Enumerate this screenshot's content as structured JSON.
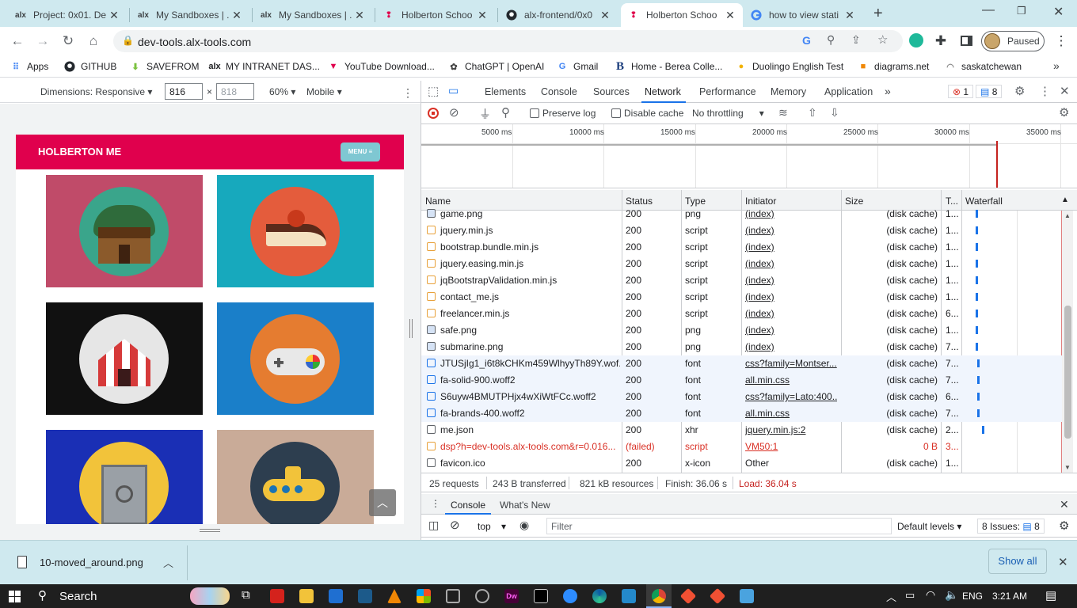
{
  "tabs": [
    {
      "icon": "alx",
      "title": "Project: 0x01. De"
    },
    {
      "icon": "alx",
      "title": "My Sandboxes | ."
    },
    {
      "icon": "alx",
      "title": "My Sandboxes | ."
    },
    {
      "icon": "holberton",
      "title": "Holberton Schoo"
    },
    {
      "icon": "github",
      "title": "alx-frontend/0x0"
    },
    {
      "icon": "holberton",
      "title": "Holberton Schoo"
    },
    {
      "icon": "google",
      "title": "how to view stati"
    }
  ],
  "address_bar": {
    "url": "dev-tools.alx-tools.com"
  },
  "profile": {
    "label": "Paused"
  },
  "bookmarks": [
    "Apps",
    "GITHUB",
    "SAVEFROM",
    "MY INTRANET DAS...",
    "YouTube Download...",
    "ChatGPT | OpenAI",
    "Gmail",
    "Home - Berea Colle...",
    "Duolingo English Test",
    "diagrams.net",
    "saskatchewan"
  ],
  "device_toolbar": {
    "dimensions_label": "Dimensions: Responsive",
    "width": "816",
    "height": "818",
    "zoom": "60%",
    "mode": "Mobile"
  },
  "site": {
    "brand": "HOLBERTON ME",
    "menu_label": "MENU ≡",
    "scroll_top_icon": "chevron-up-icon"
  },
  "devtools": {
    "tabs": [
      "Elements",
      "Console",
      "Sources",
      "Network",
      "Performance",
      "Memory",
      "Application"
    ],
    "selected_tab": "Network",
    "errors_count": "1",
    "messages_count": "8",
    "network_bar": {
      "preserve_log": "Preserve log",
      "disable_cache": "Disable cache",
      "throttling": "No throttling"
    },
    "overview_ticks": [
      "5000 ms",
      "10000 ms",
      "15000 ms",
      "20000 ms",
      "25000 ms",
      "30000 ms",
      "35000 ms"
    ],
    "columns": [
      "Name",
      "Status",
      "Type",
      "Initiator",
      "Size",
      "T...",
      "Waterfall"
    ],
    "rows": [
      {
        "name": "game.png",
        "status": "200",
        "type": "png",
        "initiator": "(index)",
        "size": "(disk cache)",
        "time": "1...",
        "kind": "img"
      },
      {
        "name": "jquery.min.js",
        "status": "200",
        "type": "script",
        "initiator": "(index)",
        "size": "(disk cache)",
        "time": "1...",
        "kind": "script"
      },
      {
        "name": "bootstrap.bundle.min.js",
        "status": "200",
        "type": "script",
        "initiator": "(index)",
        "size": "(disk cache)",
        "time": "1...",
        "kind": "script"
      },
      {
        "name": "jquery.easing.min.js",
        "status": "200",
        "type": "script",
        "initiator": "(index)",
        "size": "(disk cache)",
        "time": "1...",
        "kind": "script"
      },
      {
        "name": "jqBootstrapValidation.min.js",
        "status": "200",
        "type": "script",
        "initiator": "(index)",
        "size": "(disk cache)",
        "time": "1...",
        "kind": "script"
      },
      {
        "name": "contact_me.js",
        "status": "200",
        "type": "script",
        "initiator": "(index)",
        "size": "(disk cache)",
        "time": "1...",
        "kind": "script"
      },
      {
        "name": "freelancer.min.js",
        "status": "200",
        "type": "script",
        "initiator": "(index)",
        "size": "(disk cache)",
        "time": "6...",
        "kind": "script"
      },
      {
        "name": "safe.png",
        "status": "200",
        "type": "png",
        "initiator": "(index)",
        "size": "(disk cache)",
        "time": "1...",
        "kind": "img"
      },
      {
        "name": "submarine.png",
        "status": "200",
        "type": "png",
        "initiator": "(index)",
        "size": "(disk cache)",
        "time": "7...",
        "kind": "img"
      },
      {
        "name": "JTUSjIg1_i6t8kCHKm459WlhyyTh89Y.wof...",
        "status": "200",
        "type": "font",
        "initiator": "css?family=Montser...",
        "size": "(disk cache)",
        "time": "7...",
        "kind": "font"
      },
      {
        "name": "fa-solid-900.woff2",
        "status": "200",
        "type": "font",
        "initiator": "all.min.css",
        "size": "(disk cache)",
        "time": "7...",
        "kind": "font"
      },
      {
        "name": "S6uyw4BMUTPHjx4wXiWtFCc.woff2",
        "status": "200",
        "type": "font",
        "initiator": "css?family=Lato:400...",
        "size": "(disk cache)",
        "time": "6...",
        "kind": "font"
      },
      {
        "name": "fa-brands-400.woff2",
        "status": "200",
        "type": "font",
        "initiator": "all.min.css",
        "size": "(disk cache)",
        "time": "7...",
        "kind": "font"
      },
      {
        "name": "me.json",
        "status": "200",
        "type": "xhr",
        "initiator": "jquery.min.js:2",
        "size": "(disk cache)",
        "time": "2...",
        "kind": "doc"
      },
      {
        "name": "dsp?h=dev-tools.alx-tools.com&r=0.016...",
        "status": "(failed)",
        "type": "script",
        "initiator": "VM50:1",
        "size": "0 B",
        "time": "3...",
        "kind": "script"
      },
      {
        "name": "favicon.ico",
        "status": "200",
        "type": "x-icon",
        "initiator": "Other",
        "size": "(disk cache)",
        "time": "1...",
        "kind": "doc"
      }
    ],
    "summary": {
      "requests": "25 requests",
      "transferred": "243 B transferred",
      "resources": "821 kB resources",
      "finish": "Finish: 36.06 s",
      "load": "Load: 36.04 s"
    },
    "drawer": {
      "tabs": [
        "Console",
        "What's New"
      ],
      "context": "top",
      "filter_placeholder": "Filter",
      "levels": "Default levels",
      "issues": "8 Issues:",
      "issues_count": "8"
    }
  },
  "download": {
    "filename": "10-moved_around.png",
    "show_all": "Show all"
  },
  "taskbar": {
    "search": "Search",
    "language": "ENG",
    "time": "3:21 AM"
  }
}
